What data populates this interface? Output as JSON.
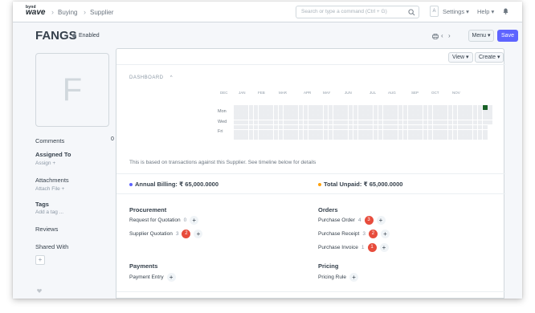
{
  "app": {
    "logo_top": "bynd",
    "logo_bottom": "wave"
  },
  "navbar": {
    "breadcrumbs": [
      "Buying",
      "Supplier"
    ],
    "search_placeholder": "Search or type a command (Ctrl + G)",
    "avatar_letter": "A",
    "settings_label": "Settings ▾",
    "help_label": "Help ▾"
  },
  "page": {
    "title": "FANGS",
    "status": "Enabled",
    "menu_label": "Menu ▾",
    "save_label": "Save",
    "view_label": "View ▾",
    "create_label": "Create ▾"
  },
  "sidebar": {
    "image_letter": "F",
    "comments_label": "Comments",
    "comments_count": "0",
    "assigned_to_label": "Assigned To",
    "assign_link": "Assign +",
    "attachments_label": "Attachments",
    "attach_file_link": "Attach File +",
    "tags_label": "Tags",
    "add_tag_link": "Add a tag ...",
    "reviews_label": "Reviews",
    "shared_with_label": "Shared With",
    "share_plus": "+"
  },
  "dashboard": {
    "label": "DASHBOARD",
    "heatmap": {
      "months": [
        "DEC",
        "JAN",
        "FEB",
        "MAR",
        "APR",
        "MAY",
        "JUN",
        "JUL",
        "AUG",
        "SEP",
        "OCT",
        "NOV"
      ],
      "days": [
        "Mon",
        "Wed",
        "Fri"
      ]
    },
    "info_text": "This is based on transactions against this Supplier. See timeline below for details",
    "annual_billing": "Annual Billing: ₹ 65,000.0000",
    "total_unpaid": "Total Unpaid: ₹ 65,000.0000",
    "colors": {
      "billing_dot": "#5e64ff",
      "unpaid_dot": "#ffa00a",
      "badge": "#e74c3c",
      "active_cell": "#196127"
    }
  },
  "connections": {
    "procurement": {
      "title": "Procurement",
      "items": [
        {
          "label": "Request for Quotation",
          "count": "0",
          "badge": ""
        },
        {
          "label": "Supplier Quotation",
          "count": "3",
          "badge": "2"
        }
      ]
    },
    "orders": {
      "title": "Orders",
      "items": [
        {
          "label": "Purchase Order",
          "count": "4",
          "badge": "3"
        },
        {
          "label": "Purchase Receipt",
          "count": "3",
          "badge": "2"
        },
        {
          "label": "Purchase Invoice",
          "count": "1",
          "badge": "1"
        }
      ]
    },
    "payments": {
      "title": "Payments",
      "items": [
        {
          "label": "Payment Entry"
        }
      ]
    },
    "pricing": {
      "title": "Pricing",
      "items": [
        {
          "label": "Pricing Rule"
        }
      ]
    }
  }
}
